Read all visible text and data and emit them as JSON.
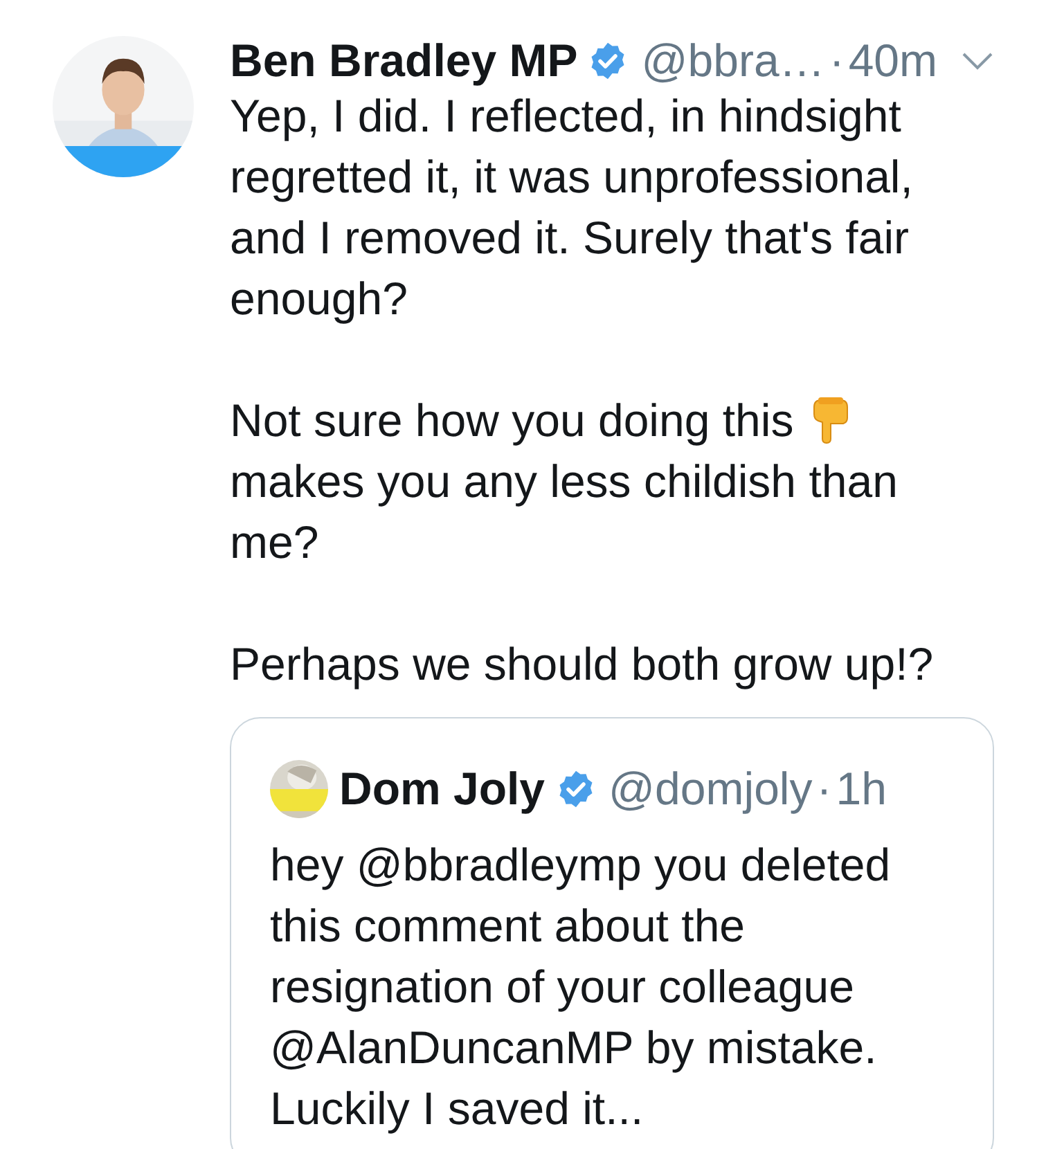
{
  "tweet": {
    "name": "Ben Bradley MP",
    "verified": true,
    "handle": "@bbra…",
    "separator": "·",
    "time": "40m",
    "body": [
      {
        "kind": "text",
        "text": "Yep, I did. I reflected, in hindsight regretted it, it was unprofessional, and I removed it. Surely that's fair enough?"
      },
      {
        "kind": "emoji",
        "before": "Not sure how you doing this",
        "after": "makes you any less childish than me?"
      },
      {
        "kind": "text",
        "text": "Perhaps we should both grow up!?"
      }
    ],
    "quoted": {
      "name": "Dom Joly",
      "verified": true,
      "handle": "@domjoly",
      "separator": "·",
      "time": "1h",
      "text": "hey @bbradleymp you deleted this comment about the resignation of your colleague @AlanDuncanMP by mistake. Luckily I saved it..."
    }
  }
}
